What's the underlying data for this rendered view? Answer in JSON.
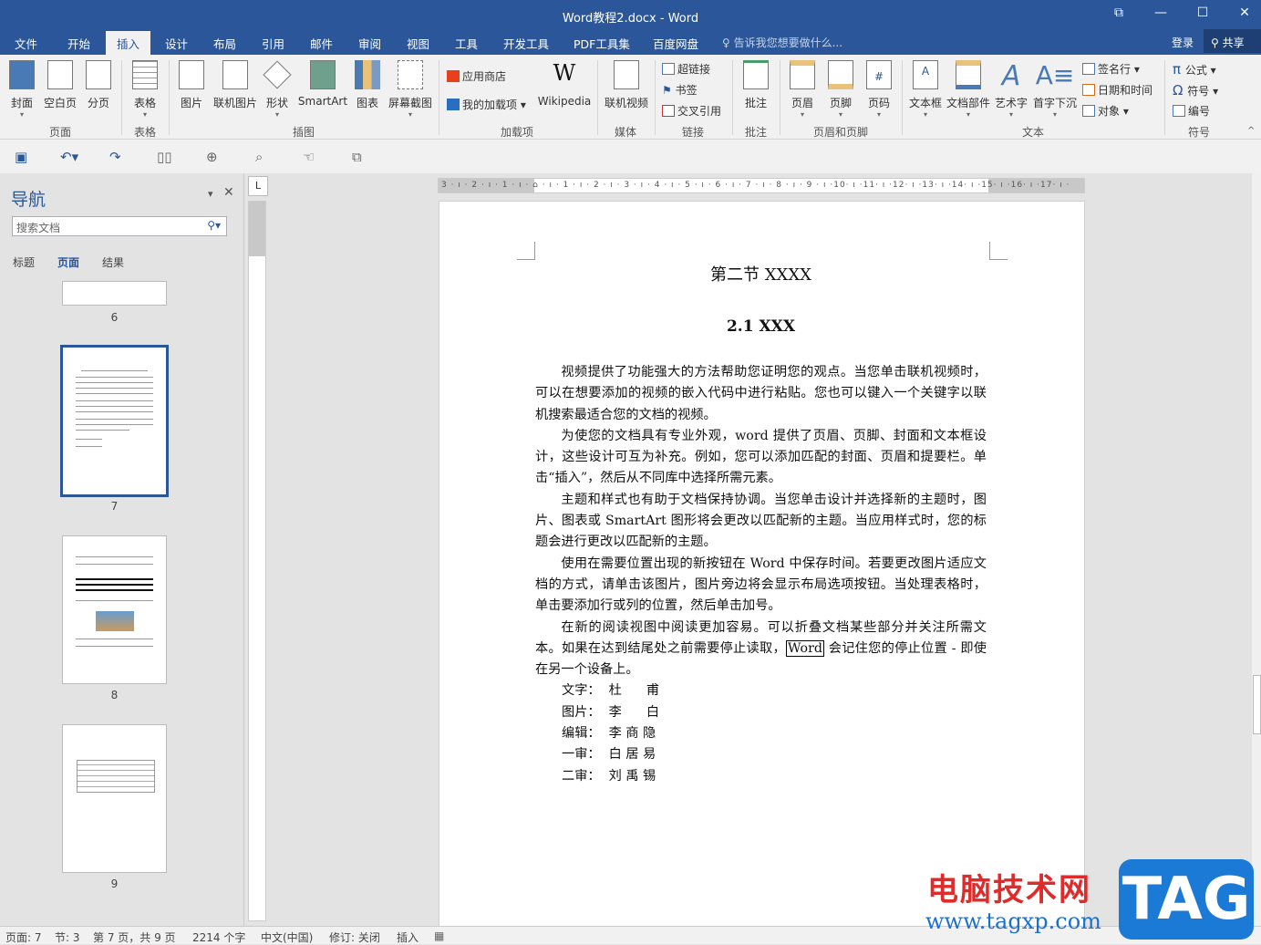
{
  "window": {
    "title": "Word教程2.docx - Word",
    "controls": [
      "⧉",
      "—",
      "☐",
      "✕"
    ]
  },
  "tabs": [
    "文件",
    "开始",
    "插入",
    "设计",
    "布局",
    "引用",
    "邮件",
    "审阅",
    "视图",
    "工具",
    "开发工具",
    "PDF工具集",
    "百度网盘"
  ],
  "active_tab": "插入",
  "tell_me": "告诉我您想要做什么...",
  "login": "登录",
  "share": "共享",
  "ribbon": {
    "pages": {
      "label": "页面",
      "items": [
        "封面",
        "空白页",
        "分页"
      ]
    },
    "tables": {
      "label": "表格",
      "items": [
        "表格"
      ]
    },
    "illustrations": {
      "label": "插图",
      "items": [
        "图片",
        "联机图片",
        "形状",
        "SmartArt",
        "图表",
        "屏幕截图"
      ]
    },
    "addins": {
      "label": "加载项",
      "store": "应用商店",
      "my_addins": "我的加载项",
      "wikipedia": "Wikipedia"
    },
    "media": {
      "label": "媒体",
      "items": [
        "联机视频"
      ]
    },
    "links": {
      "label": "链接",
      "items": [
        "超链接",
        "书签",
        "交叉引用"
      ]
    },
    "comments": {
      "label": "批注",
      "items": [
        "批注"
      ]
    },
    "header_footer": {
      "label": "页眉和页脚",
      "items": [
        "页眉",
        "页脚",
        "页码"
      ]
    },
    "text": {
      "label": "文本",
      "items": [
        "文本框",
        "文档部件",
        "艺术字",
        "首字下沉"
      ],
      "small": [
        "签名行",
        "日期和时间",
        "对象"
      ]
    },
    "symbols": {
      "label": "符号",
      "items": [
        "公式",
        "符号",
        "编号"
      ]
    }
  },
  "nav": {
    "title": "导航",
    "search_placeholder": "搜索文档",
    "tabs": [
      "标题",
      "页面",
      "结果"
    ],
    "active_tab": "页面",
    "pages": [
      "6",
      "7",
      "8",
      "9"
    ],
    "selected_page": "7"
  },
  "ruler": {
    "h": "3 · ı · 2 · ı · 1 · ı · ⌂ · ı · 1 · ı · 2 · ı · 3 · ı · 4 · ı · 5 · ı · 6 · ı · 7 · ı · 8 · ı · 9 · ı ·10· ı ·11· ı ·12· ı ·13· ı ·14· ı ·15· ı ·16· ı ·17· ı ·"
  },
  "document": {
    "heading1": "第二节  XXXX",
    "heading2": "2.1 XXX",
    "paragraphs": [
      "视频提供了功能强大的方法帮助您证明您的观点。当您单击联机视频时，可以在想要添加的视频的嵌入代码中进行粘贴。您也可以键入一个关键字以联机搜索最适合您的文档的视频。",
      "为使您的文档具有专业外观，word 提供了页眉、页脚、封面和文本框设计，这些设计可互为补充。例如，您可以添加匹配的封面、页眉和提要栏。单击“插入”，然后从不同库中选择所需元素。",
      "主题和样式也有助于文档保持协调。当您单击设计并选择新的主题时，图片、图表或 SmartArt 图形将会更改以匹配新的主题。当应用样式时，您的标题会进行更改以匹配新的主题。",
      "使用在需要位置出现的新按钮在 Word 中保存时间。若要更改图片适应文档的方式，请单击该图片，图片旁边将会显示布局选项按钮。当处理表格时，单击要添加行或列的位置，然后单击加号。"
    ],
    "p5_before": "在新的阅读视图中阅读更加容易。可以折叠文档某些部分并关注所需文本。如果在达到结尾处之前需要停止读取，",
    "p5_boxed": "Word",
    "p5_after": " 会记住您的停止位置 - 即使在另一个设备上。",
    "credits": [
      "文字：  杜      甫",
      "图片：  李      白",
      "编辑：  李 商 隐",
      "一审：  白 居 易",
      "二审：  刘 禹 锡"
    ]
  },
  "status": {
    "page": "页面: 7",
    "section": "节: 3",
    "page_of": "第 7 页，共 9 页",
    "words": "2214 个字",
    "language": "中文(中国)",
    "track": "修订: 关闭",
    "mode": "插入"
  },
  "watermark": {
    "cn": "电脑技术网",
    "url": "www.tagxp.com",
    "logo": "TAG"
  },
  "colors": {
    "accent": "#2b579a",
    "watermark_red": "#e02b2b",
    "watermark_blue": "#1b7ad6"
  }
}
